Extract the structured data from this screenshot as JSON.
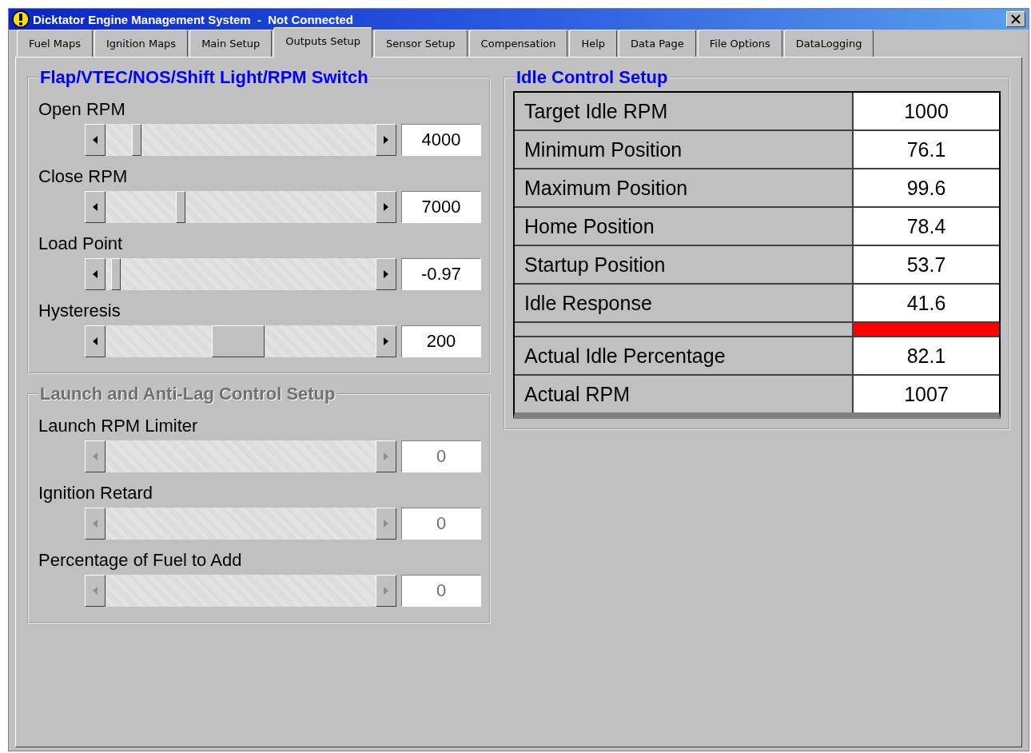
{
  "window": {
    "title": "Dicktator Engine Management System  -  Not Connected"
  },
  "tabs": [
    {
      "label": "Fuel Maps",
      "selected": false
    },
    {
      "label": "Ignition Maps",
      "selected": false
    },
    {
      "label": "Main Setup",
      "selected": false
    },
    {
      "label": "Outputs Setup",
      "selected": true
    },
    {
      "label": "Sensor Setup",
      "selected": false
    },
    {
      "label": "Compensation",
      "selected": false
    },
    {
      "label": "Help",
      "selected": false
    },
    {
      "label": "Data Page",
      "selected": false
    },
    {
      "label": "File Options",
      "selected": false
    },
    {
      "label": "DataLogging",
      "selected": false
    }
  ],
  "switch_group": {
    "title": "Flap/VTEC/NOS/Shift Light/RPM Switch",
    "disabled": false,
    "sliders": [
      {
        "label": "Open RPM",
        "value": "4000",
        "level": 0.1,
        "kind": "narrow",
        "disabled": false
      },
      {
        "label": "Close RPM",
        "value": "7000",
        "level": 0.27,
        "kind": "narrow",
        "disabled": false
      },
      {
        "label": "Load Point",
        "value": "-0.97",
        "level": 0.02,
        "kind": "narrow",
        "disabled": false
      },
      {
        "label": "Hysteresis",
        "value": "200",
        "level": 0.49,
        "kind": "wide",
        "disabled": false
      }
    ]
  },
  "launch_group": {
    "title": "Launch and Anti-Lag Control Setup",
    "disabled": true,
    "sliders": [
      {
        "label": "Launch RPM Limiter",
        "value": "0",
        "disabled": true
      },
      {
        "label": "Ignition Retard",
        "value": "0",
        "disabled": true
      },
      {
        "label": "Percentage of Fuel to Add",
        "value": "0",
        "disabled": true
      }
    ]
  },
  "idle_group": {
    "title": "Idle Control Setup",
    "rows": [
      {
        "kind": "value",
        "label": "Target Idle RPM",
        "value": "1000"
      },
      {
        "kind": "value",
        "label": "Minimum Position",
        "value": "76.1"
      },
      {
        "kind": "value",
        "label": "Maximum Position",
        "value": "99.6"
      },
      {
        "kind": "value",
        "label": "Home Position",
        "value": "78.4"
      },
      {
        "kind": "value",
        "label": "Startup Position",
        "value": "53.7"
      },
      {
        "kind": "value",
        "label": "Idle Response",
        "value": "41.6"
      },
      {
        "kind": "indicator",
        "color": "#ff0000"
      },
      {
        "kind": "value",
        "label": "Actual Idle Percentage",
        "value": "82.1"
      },
      {
        "kind": "value",
        "label": "Actual RPM",
        "value": "1007"
      }
    ]
  }
}
